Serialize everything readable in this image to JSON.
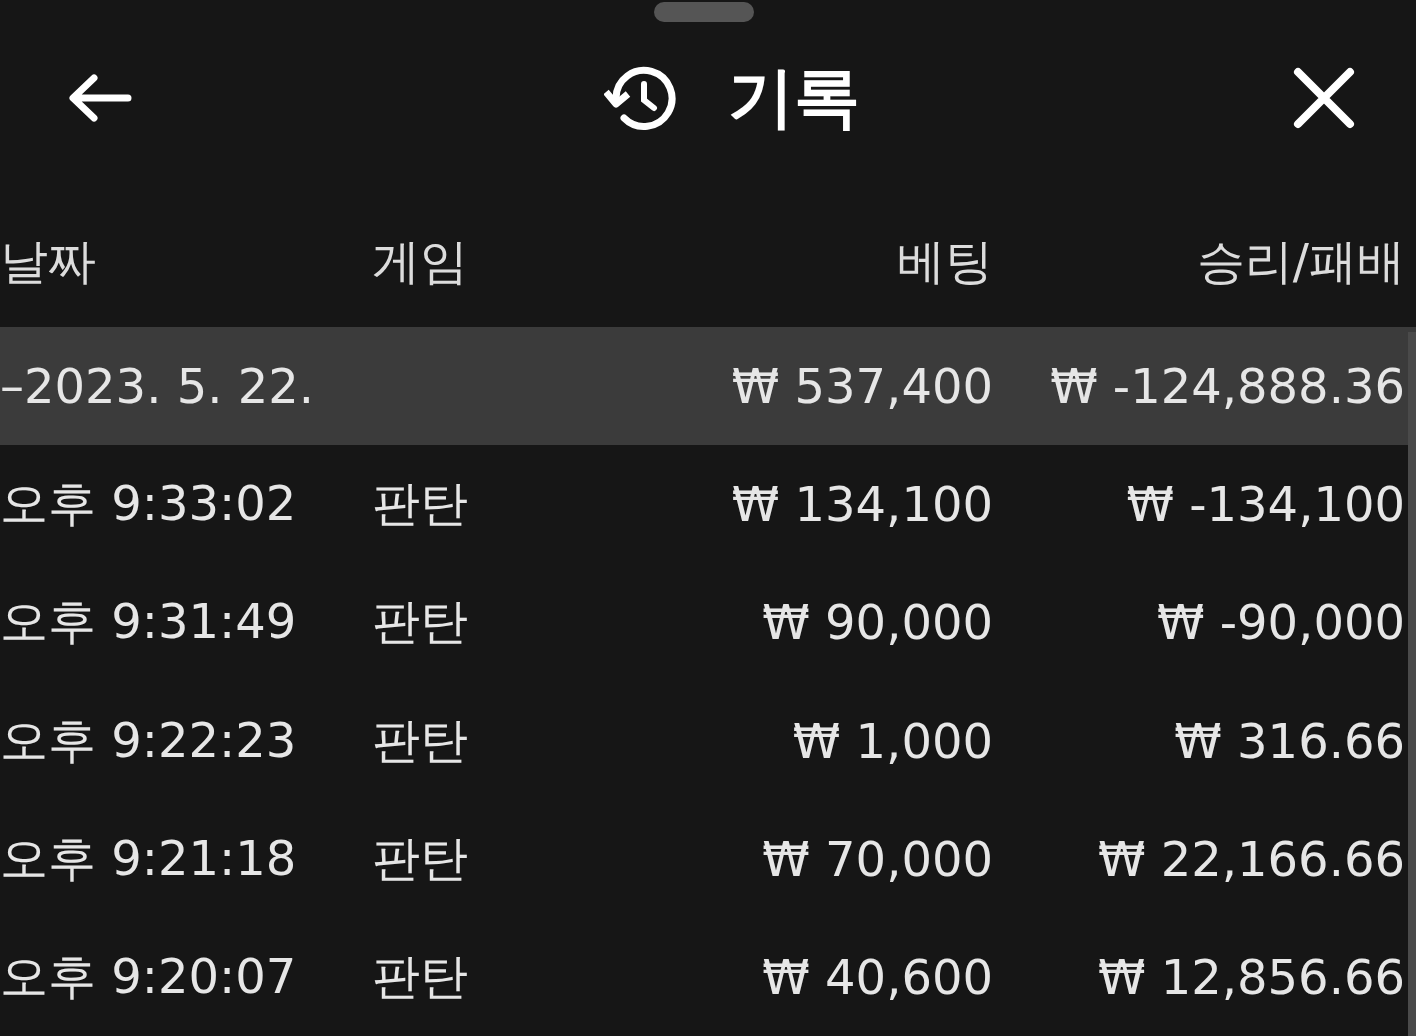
{
  "header": {
    "title": "기록"
  },
  "table": {
    "columns": [
      "날짜",
      "게임",
      "베팅",
      "승리/패배"
    ],
    "rows": [
      {
        "kind": "date",
        "date": "–2023. 5. 22.",
        "bet": "₩ 537,400",
        "result": "₩ -124,888.36"
      },
      {
        "kind": "entry",
        "date": "오후 9:33:02",
        "game": "판탄",
        "bet": "₩ 134,100",
        "result": "₩ -134,100"
      },
      {
        "kind": "entry",
        "date": "오후 9:31:49",
        "game": "판탄",
        "bet": "₩ 90,000",
        "result": "₩ -90,000"
      },
      {
        "kind": "entry",
        "date": "오후 9:22:23",
        "game": "판탄",
        "bet": "₩ 1,000",
        "result": "₩ 316.66"
      },
      {
        "kind": "entry",
        "date": "오후 9:21:18",
        "game": "판탄",
        "bet": "₩ 70,000",
        "result": "₩ 22,166.66"
      },
      {
        "kind": "entry",
        "date": "오후 9:20:07",
        "game": "판탄",
        "bet": "₩ 40,600",
        "result": "₩ 12,856.66"
      }
    ]
  }
}
